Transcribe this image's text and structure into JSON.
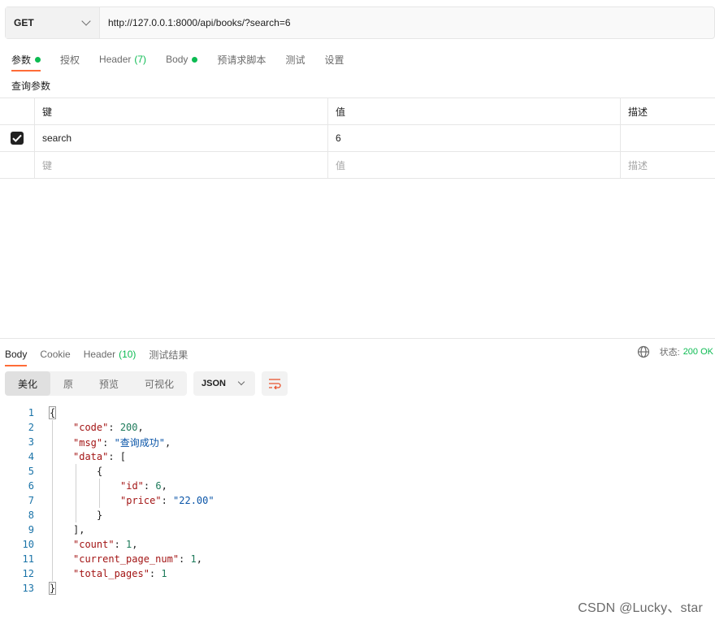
{
  "request": {
    "method": "GET",
    "url": "http://127.0.0.1:8000/api/books/?search=6"
  },
  "request_tabs": [
    {
      "label": "参数",
      "dot": true,
      "active": true
    },
    {
      "label": "授权"
    },
    {
      "label": "Header",
      "count": "(7)"
    },
    {
      "label": "Body",
      "dot": true
    },
    {
      "label": "预请求脚本"
    },
    {
      "label": "测试"
    },
    {
      "label": "设置"
    }
  ],
  "params": {
    "title": "查询参数",
    "headers": {
      "key": "键",
      "value": "值",
      "description": "描述"
    },
    "rows": [
      {
        "checked": true,
        "key": "search",
        "value": "6",
        "description": ""
      }
    ],
    "placeholder": {
      "key": "键",
      "value": "值",
      "description": "描述"
    }
  },
  "response_tabs": [
    {
      "label": "Body",
      "active": true
    },
    {
      "label": "Cookie"
    },
    {
      "label": "Header",
      "count": "(10)"
    },
    {
      "label": "测试结果"
    }
  ],
  "status": {
    "label": "状态:",
    "code": "200 OK"
  },
  "view_modes": [
    "美化",
    "原",
    "预览",
    "可视化"
  ],
  "format": "JSON",
  "code_lines": [
    {
      "n": "1"
    },
    {
      "n": "2"
    },
    {
      "n": "3"
    },
    {
      "n": "4"
    },
    {
      "n": "5"
    },
    {
      "n": "6"
    },
    {
      "n": "7"
    },
    {
      "n": "8"
    },
    {
      "n": "9"
    },
    {
      "n": "10"
    },
    {
      "n": "11"
    },
    {
      "n": "12"
    },
    {
      "n": "13"
    }
  ],
  "json_body": {
    "code_key": "\"code\"",
    "code_val": "200",
    "msg_key": "\"msg\"",
    "msg_val": "\"查询成功\"",
    "data_key": "\"data\"",
    "id_key": "\"id\"",
    "id_val": "6",
    "price_key": "\"price\"",
    "price_val": "\"22.00\"",
    "count_key": "\"count\"",
    "count_val": "1",
    "cpn_key": "\"current_page_num\"",
    "cpn_val": "1",
    "tp_key": "\"total_pages\"",
    "tp_val": "1"
  },
  "watermark": "CSDN @Lucky、star",
  "colors": {
    "accent": "#ff6c37",
    "success": "#0cbb52",
    "json_key": "#a31515",
    "json_string": "#0a55a8",
    "json_number": "#1d7a5a"
  }
}
